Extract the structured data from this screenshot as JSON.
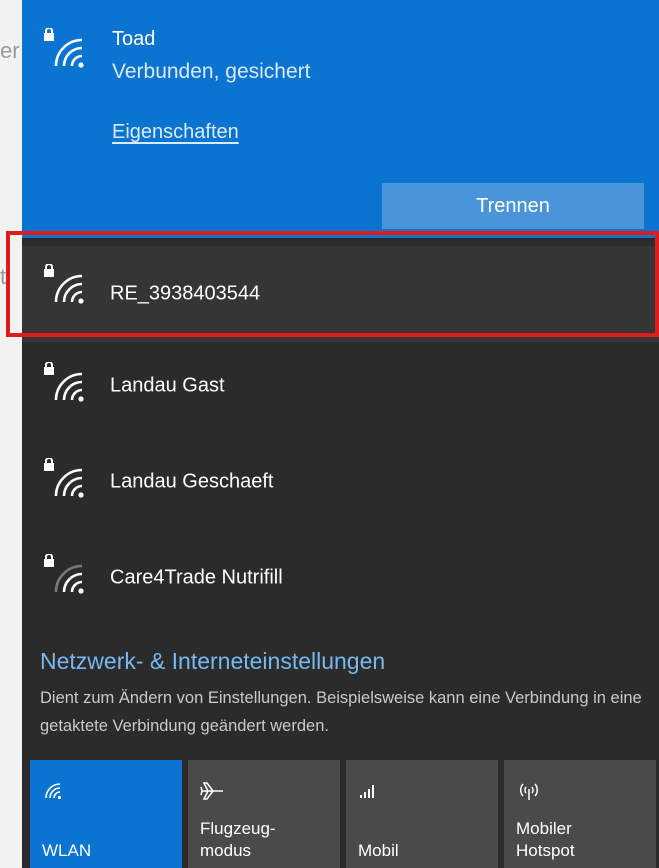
{
  "background": {
    "fragments": [
      "er",
      "t",
      "te"
    ]
  },
  "connected_network": {
    "name": "Toad",
    "status": "Verbunden, gesichert",
    "properties_link": "Eigenschaften",
    "disconnect_button": "Trennen",
    "icon": "secured-wifi-icon"
  },
  "networks": [
    {
      "name": "RE_3938403544",
      "icon": "secured-wifi-icon",
      "highlighted": true
    },
    {
      "name": "Landau Gast",
      "icon": "secured-wifi-icon"
    },
    {
      "name": "Landau Geschaeft",
      "icon": "secured-wifi-icon"
    },
    {
      "name": "Care4Trade Nutrifill",
      "icon": "secured-wifi-weak-icon"
    }
  ],
  "settings": {
    "title": "Netzwerk- & Interneteinstellungen",
    "description": "Dient zum Ändern von Einstellungen. Beispielsweise kann eine Verbindung in eine getaktete Verbindung geändert werden."
  },
  "quick_actions": [
    {
      "label": "WLAN",
      "icon": "wifi-icon",
      "active": true
    },
    {
      "label": "Flugzeug-\nmodus",
      "icon": "airplane-icon",
      "active": false
    },
    {
      "label": "Mobil",
      "icon": "cellular-signal-icon",
      "active": false
    },
    {
      "label": "Mobiler\nHotspot",
      "icon": "hotspot-icon",
      "active": false
    }
  ],
  "colors": {
    "accent": "#0a74d0",
    "panel": "#2b2b2b",
    "selected_row": "#353535",
    "highlight": "#e01d1d",
    "tile": "#4a4a4a",
    "link": "#76b9f0"
  }
}
